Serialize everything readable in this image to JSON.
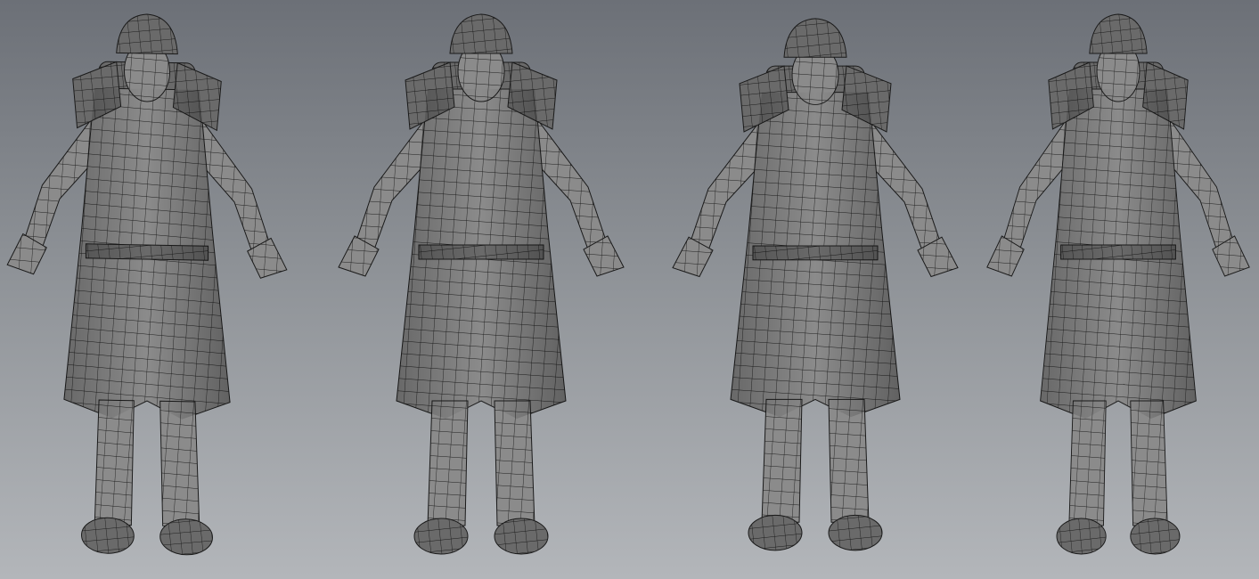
{
  "colors": {
    "background_top": "#6c7077",
    "background_bottom": "#b3b6ba",
    "mesh_fill": "#8b8b8b",
    "mesh_shadow": "#5e5e5e",
    "wire": "#1e1e1e"
  }
}
